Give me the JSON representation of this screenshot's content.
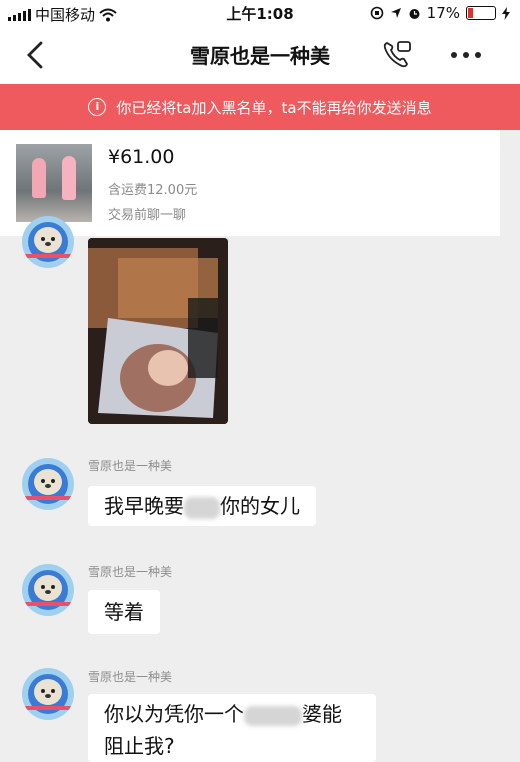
{
  "status_bar": {
    "carrier": "中国移动",
    "time": "上午1:08",
    "battery": "17%",
    "battery_level": 0.17
  },
  "header": {
    "title": "雪原也是一种美",
    "back_icon": "chevron-left-icon",
    "call_icon": "phone-video-icon",
    "more_icon": "more-dots-icon"
  },
  "banner": {
    "text": "你已经将ta加入黑名单，ta不能再给你发送消息",
    "color": "#ee5a5e"
  },
  "product": {
    "price": "¥61.00",
    "shipping": "含运费12.00元",
    "chat_hint": "交易前聊一聊"
  },
  "messages": [
    {
      "sender": "雪原也是一种美",
      "text_before": "我早晚要",
      "text_after": "你的女儿"
    },
    {
      "sender": "雪原也是一种美",
      "text": "等着"
    },
    {
      "sender": "雪原也是一种美",
      "line1_before": "你以为凭你一个",
      "line1_after": "婆能",
      "line2": "阻止我?"
    }
  ]
}
